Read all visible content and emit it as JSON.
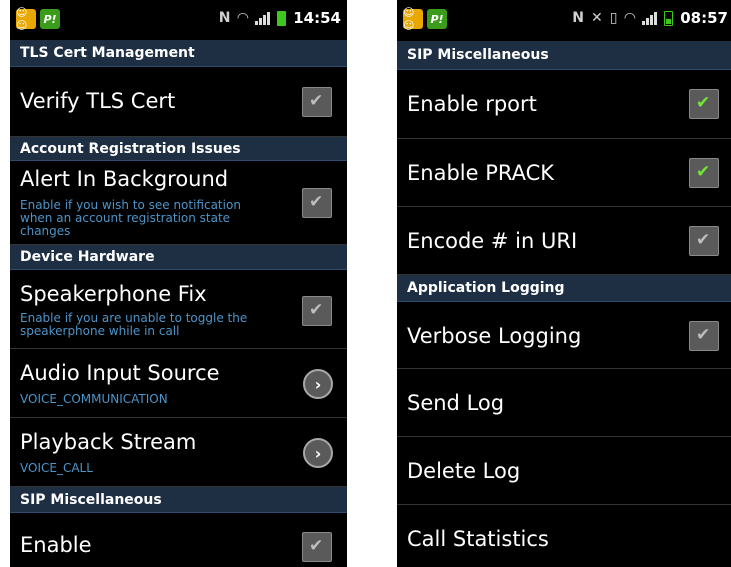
{
  "left": {
    "status": {
      "kids_icon": "kids-icon",
      "pl_icon": "P!",
      "nfc": "N",
      "time": "14:54"
    },
    "sections": {
      "tls": "TLS Cert Management",
      "account": "Account Registration Issues",
      "hardware": "Device Hardware",
      "sip": "SIP Miscellaneous"
    },
    "items": {
      "verify_tls": {
        "title": "Verify TLS Cert",
        "checked": false
      },
      "alert_bg": {
        "title": "Alert In Background",
        "summary": [
          "Enable if you wish to see notification",
          "when an account registration state",
          "changes"
        ],
        "checked": false
      },
      "speaker_fix": {
        "title": "Speakerphone Fix",
        "summary": [
          "Enable if you are unable to toggle the",
          "speakerphone while in call"
        ],
        "checked": false
      },
      "audio_input": {
        "title": "Audio Input Source",
        "summary": "VOICE_COMMUNICATION"
      },
      "playback": {
        "title": "Playback Stream",
        "summary": "VOICE_CALL"
      },
      "partial": {
        "title": "Enable"
      }
    }
  },
  "right": {
    "status": {
      "kids_icon": "kids-icon",
      "pl_icon": "P!",
      "nfc": "N",
      "time": "08:57"
    },
    "sections": {
      "sip": "SIP Miscellaneous",
      "logging": "Application Logging"
    },
    "items": {
      "rport": {
        "title": "Enable rport",
        "checked": true
      },
      "prack": {
        "title": "Enable PRACK",
        "checked": true
      },
      "encode": {
        "title": "Encode # in URI",
        "checked": false
      },
      "verbose": {
        "title": "Verbose Logging",
        "checked": false
      },
      "send_log": {
        "title": "Send Log"
      },
      "delete_log": {
        "title": "Delete Log"
      },
      "call_stats": {
        "title": "Call Statistics"
      }
    }
  },
  "colors": {
    "section_bg": "#1e2f44",
    "summary_text": "#4d94c8",
    "check_on": "#6fe832",
    "check_off": "#bdbdbd"
  }
}
